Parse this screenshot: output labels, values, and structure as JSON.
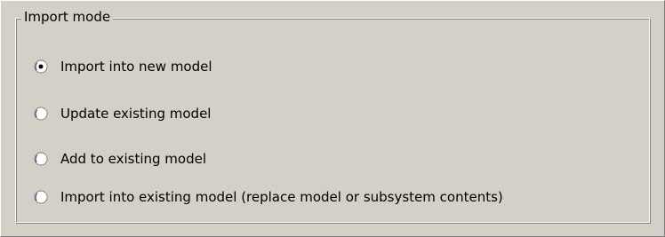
{
  "group": {
    "title": "Import mode"
  },
  "options": [
    {
      "label": "Import into new model",
      "selected": true,
      "icon": "radio-checked-icon"
    },
    {
      "label": "Update existing model",
      "selected": false,
      "icon": "radio-unchecked-icon"
    },
    {
      "label": "Add to existing model",
      "selected": false,
      "icon": "radio-unchecked-icon"
    },
    {
      "label": "Import into existing model (replace model or subsystem contents)",
      "selected": false,
      "icon": "radio-unchecked-icon"
    }
  ],
  "colors": {
    "background": "#d4d0c8",
    "highlight": "#ffffff",
    "shadow": "#808080",
    "text": "#000000"
  }
}
